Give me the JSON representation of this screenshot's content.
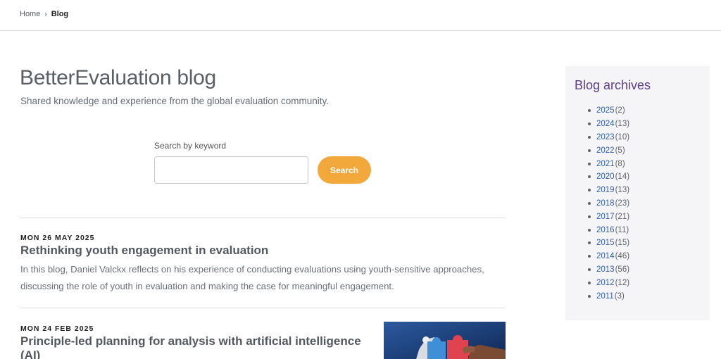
{
  "breadcrumb": {
    "home": "Home",
    "separator": "›",
    "current": "Blog"
  },
  "page": {
    "title": "BetterEvaluation blog",
    "subtitle": "Shared knowledge and experience from the global evaluation community."
  },
  "search": {
    "label": "Search by keyword",
    "value": "",
    "placeholder": "",
    "button_label": "Search"
  },
  "posts": [
    {
      "date": "MON 26 MAY 2025",
      "title": "Rethinking youth engagement in evaluation",
      "excerpt_line1": "In this blog, Daniel Valckx reflects on his experience of conducting evaluations using youth-sensitive approaches,",
      "excerpt_line2": "discussing the role of youth in evaluation and making the case for meaningful engagement."
    },
    {
      "date": "MON 24 FEB 2025",
      "title_line1": "Principle-led planning for analysis with artificial intelligence",
      "title_line2": "(AI)"
    }
  ],
  "sidebar": {
    "title": "Blog archives",
    "archives": [
      {
        "year": "2025",
        "count": "(2)"
      },
      {
        "year": "2024",
        "count": "(13)"
      },
      {
        "year": "2023",
        "count": "(10)"
      },
      {
        "year": "2022",
        "count": "(5)"
      },
      {
        "year": "2021",
        "count": "(8)"
      },
      {
        "year": "2020",
        "count": "(14)"
      },
      {
        "year": "2019",
        "count": "(13)"
      },
      {
        "year": "2018",
        "count": "(23)"
      },
      {
        "year": "2017",
        "count": "(21)"
      },
      {
        "year": "2016",
        "count": "(11)"
      },
      {
        "year": "2015",
        "count": "(15)"
      },
      {
        "year": "2014",
        "count": "(46)"
      },
      {
        "year": "2013",
        "count": "(56)"
      },
      {
        "year": "2012",
        "count": "(12)"
      },
      {
        "year": "2011",
        "count": "(3)"
      }
    ]
  },
  "colors": {
    "accent": "#f2a83b",
    "link": "#2f5fb5",
    "sidebar_title": "#5d3d8a"
  }
}
